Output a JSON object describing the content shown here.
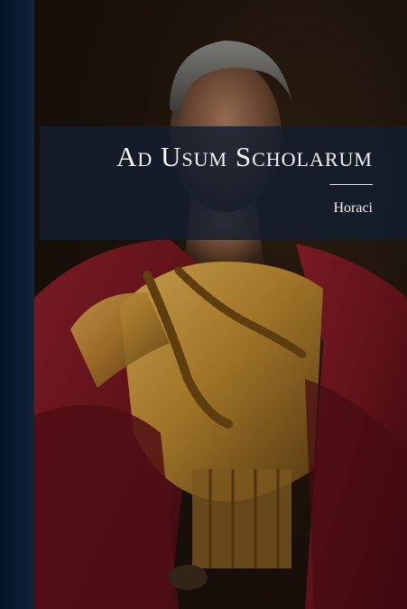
{
  "cover": {
    "title": "Ad Usum Scholarum",
    "author": "Horaci",
    "illustration": "roman-general-portrait",
    "colors": {
      "spine": "#0c1c33",
      "band": "#121e30",
      "text": "#f2f2f2",
      "cloak": "#7a1a22",
      "armor": "#b8862e"
    }
  }
}
